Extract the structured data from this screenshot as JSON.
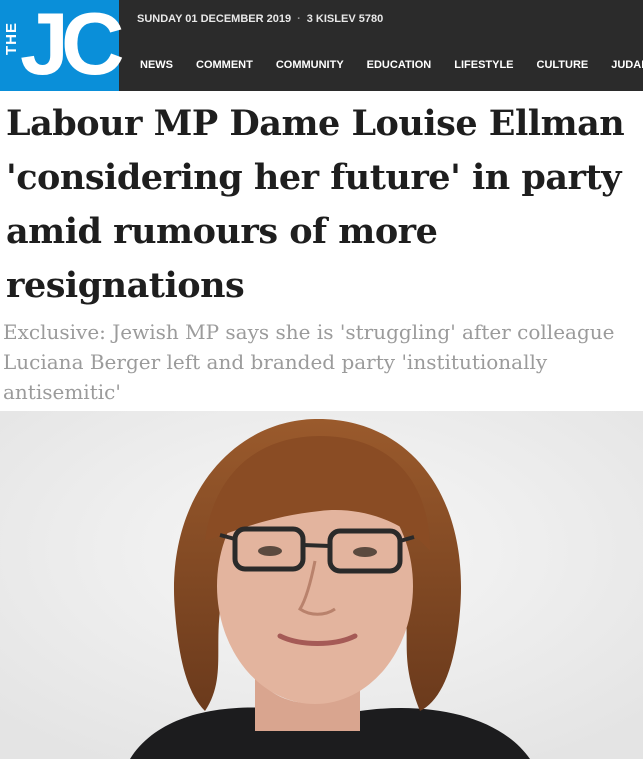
{
  "brand": {
    "logo_small": "THE",
    "logo_large": "JC",
    "logo_color": "#0a8fd9"
  },
  "header": {
    "date": "SUNDAY 01 DECEMBER 2019",
    "separator": "·",
    "hebrew_date": "3 KISLEV 5780",
    "background": "#2b2b2b"
  },
  "nav": {
    "items": [
      {
        "label": "NEWS"
      },
      {
        "label": "COMMENT"
      },
      {
        "label": "COMMUNITY"
      },
      {
        "label": "EDUCATION"
      },
      {
        "label": "LIFESTYLE"
      },
      {
        "label": "CULTURE"
      },
      {
        "label": "JUDAIS"
      }
    ]
  },
  "article": {
    "headline": "Labour MP Dame Louise Ellman 'considering her future' in party amid rumours of more resignations",
    "standfirst": "Exclusive: Jewish MP says she is 'struggling' after colleague Luciana Berger left and branded party 'institutionally antisemitic'"
  },
  "photo": {
    "subject": "portrait of a woman with auburn bob hair and dark-framed glasses",
    "background_color": "#f2f2f2"
  }
}
